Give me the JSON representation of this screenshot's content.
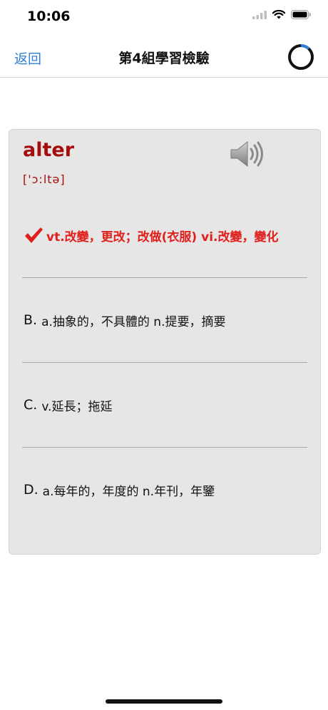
{
  "status_bar": {
    "time": "10:06"
  },
  "nav": {
    "back_label": "返回",
    "title": "第4組學習檢驗",
    "progress_fraction": 0.12
  },
  "card": {
    "word": "alter",
    "phonetic": "['ɔ:ltə]",
    "options": [
      {
        "letter": "",
        "text": "vt.改變，更改；改做(衣服) vi.改變，變化",
        "state": "correct"
      },
      {
        "letter": "B.",
        "text": "a.抽象的，不具體的 n.提要，摘要",
        "state": "normal"
      },
      {
        "letter": "C.",
        "text": "v.延長；拖延",
        "state": "normal"
      },
      {
        "letter": "D.",
        "text": "a.每年的，年度的 n.年刊，年鑒",
        "state": "normal"
      }
    ]
  },
  "icons": {
    "speaker": "speaker-icon",
    "check": "checkmark-icon",
    "signal": "signal-icon",
    "wifi": "wifi-icon",
    "battery": "battery-icon"
  },
  "colors": {
    "accent": "#2f7fd6",
    "word": "#a50d0d",
    "correct": "#e0201c",
    "card_bg": "#e6e6e6"
  }
}
